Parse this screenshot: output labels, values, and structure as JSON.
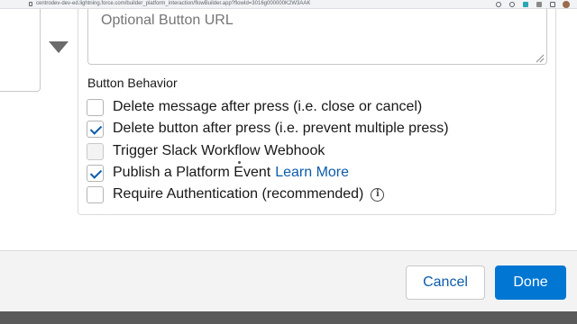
{
  "browser": {
    "url": "centrodev-dev-ed.lightning.force.com/builder_platform_interaction/flowBuilder.app?flowId=3016g000000K2W3AAK"
  },
  "url_field": {
    "placeholder": "Optional Button URL"
  },
  "button_behavior": {
    "label": "Button Behavior",
    "options": [
      {
        "label": "Delete message after press (i.e. close or cancel)",
        "checked": false,
        "disabled": false
      },
      {
        "label": "Delete button after press (i.e. prevent multiple press)",
        "checked": true,
        "disabled": false
      },
      {
        "label": "Trigger Slack Workflow Webhook",
        "checked": false,
        "disabled": true
      },
      {
        "label": "Publish a Platform Event",
        "checked": true,
        "disabled": false,
        "link": "Learn More"
      },
      {
        "label": "Require Authentication (recommended)",
        "checked": false,
        "disabled": false,
        "info_icon": "i"
      }
    ]
  },
  "footer": {
    "cancel_label": "Cancel",
    "done_label": "Done"
  },
  "colors": {
    "brand": "#0176d3",
    "link": "#0b5cab",
    "footer_bg": "#f3f3f3"
  }
}
